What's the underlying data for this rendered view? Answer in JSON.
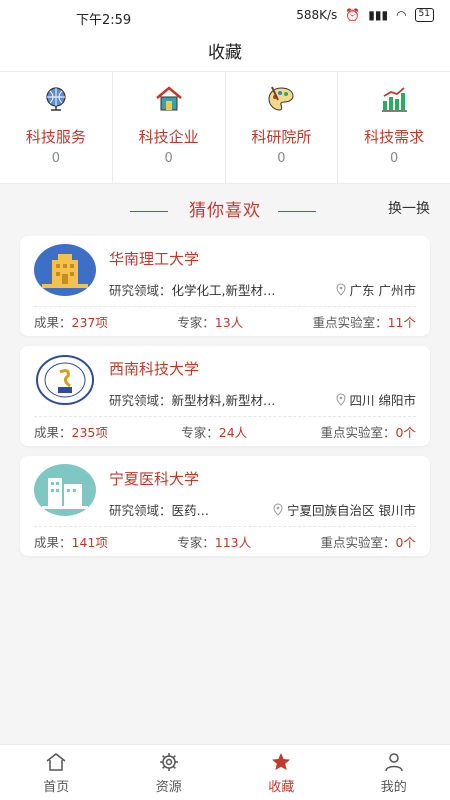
{
  "status_bar": {
    "time": "下午2:59",
    "speed": "588K/s",
    "battery": "51"
  },
  "header": {
    "title": "收藏"
  },
  "categories": [
    {
      "label": "科技服务",
      "count": "0",
      "icon": "globe-icon"
    },
    {
      "label": "科技企业",
      "count": "0",
      "icon": "house-icon"
    },
    {
      "label": "科研院所",
      "count": "0",
      "icon": "palette-icon"
    },
    {
      "label": "科技需求",
      "count": "0",
      "icon": "bar-chart-icon"
    }
  ],
  "section": {
    "title": "猜你喜欢",
    "refresh": "换一换"
  },
  "cards": [
    {
      "name": "华南理工大学",
      "field_label": "研究领域：",
      "field_value": "化学化工,新型材…",
      "location": "广东 广州市",
      "results_label": "成果：",
      "results_value": "237项",
      "experts_label": "专家：",
      "experts_value": "13人",
      "labs_label": "重点实验室：",
      "labs_value": "11个"
    },
    {
      "name": "西南科技大学",
      "field_label": "研究领域：",
      "field_value": "新型材料,新型材…",
      "location": "四川 绵阳市",
      "results_label": "成果：",
      "results_value": "235项",
      "experts_label": "专家：",
      "experts_value": "24人",
      "labs_label": "重点实验室：",
      "labs_value": "0个"
    },
    {
      "name": "宁夏医科大学",
      "field_label": "研究领域：",
      "field_value": "医药…",
      "location": "宁夏回族自治区 银川市",
      "results_label": "成果：",
      "results_value": "141项",
      "experts_label": "专家：",
      "experts_value": "113人",
      "labs_label": "重点实验室：",
      "labs_value": "0个"
    }
  ],
  "bottom_nav": [
    {
      "label": "首页",
      "icon": "home-icon"
    },
    {
      "label": "资源",
      "icon": "gear-icon"
    },
    {
      "label": "收藏",
      "icon": "star-icon"
    },
    {
      "label": "我的",
      "icon": "user-icon"
    }
  ],
  "colors": {
    "accent": "#c0392b",
    "background": "#f5f5f5"
  }
}
